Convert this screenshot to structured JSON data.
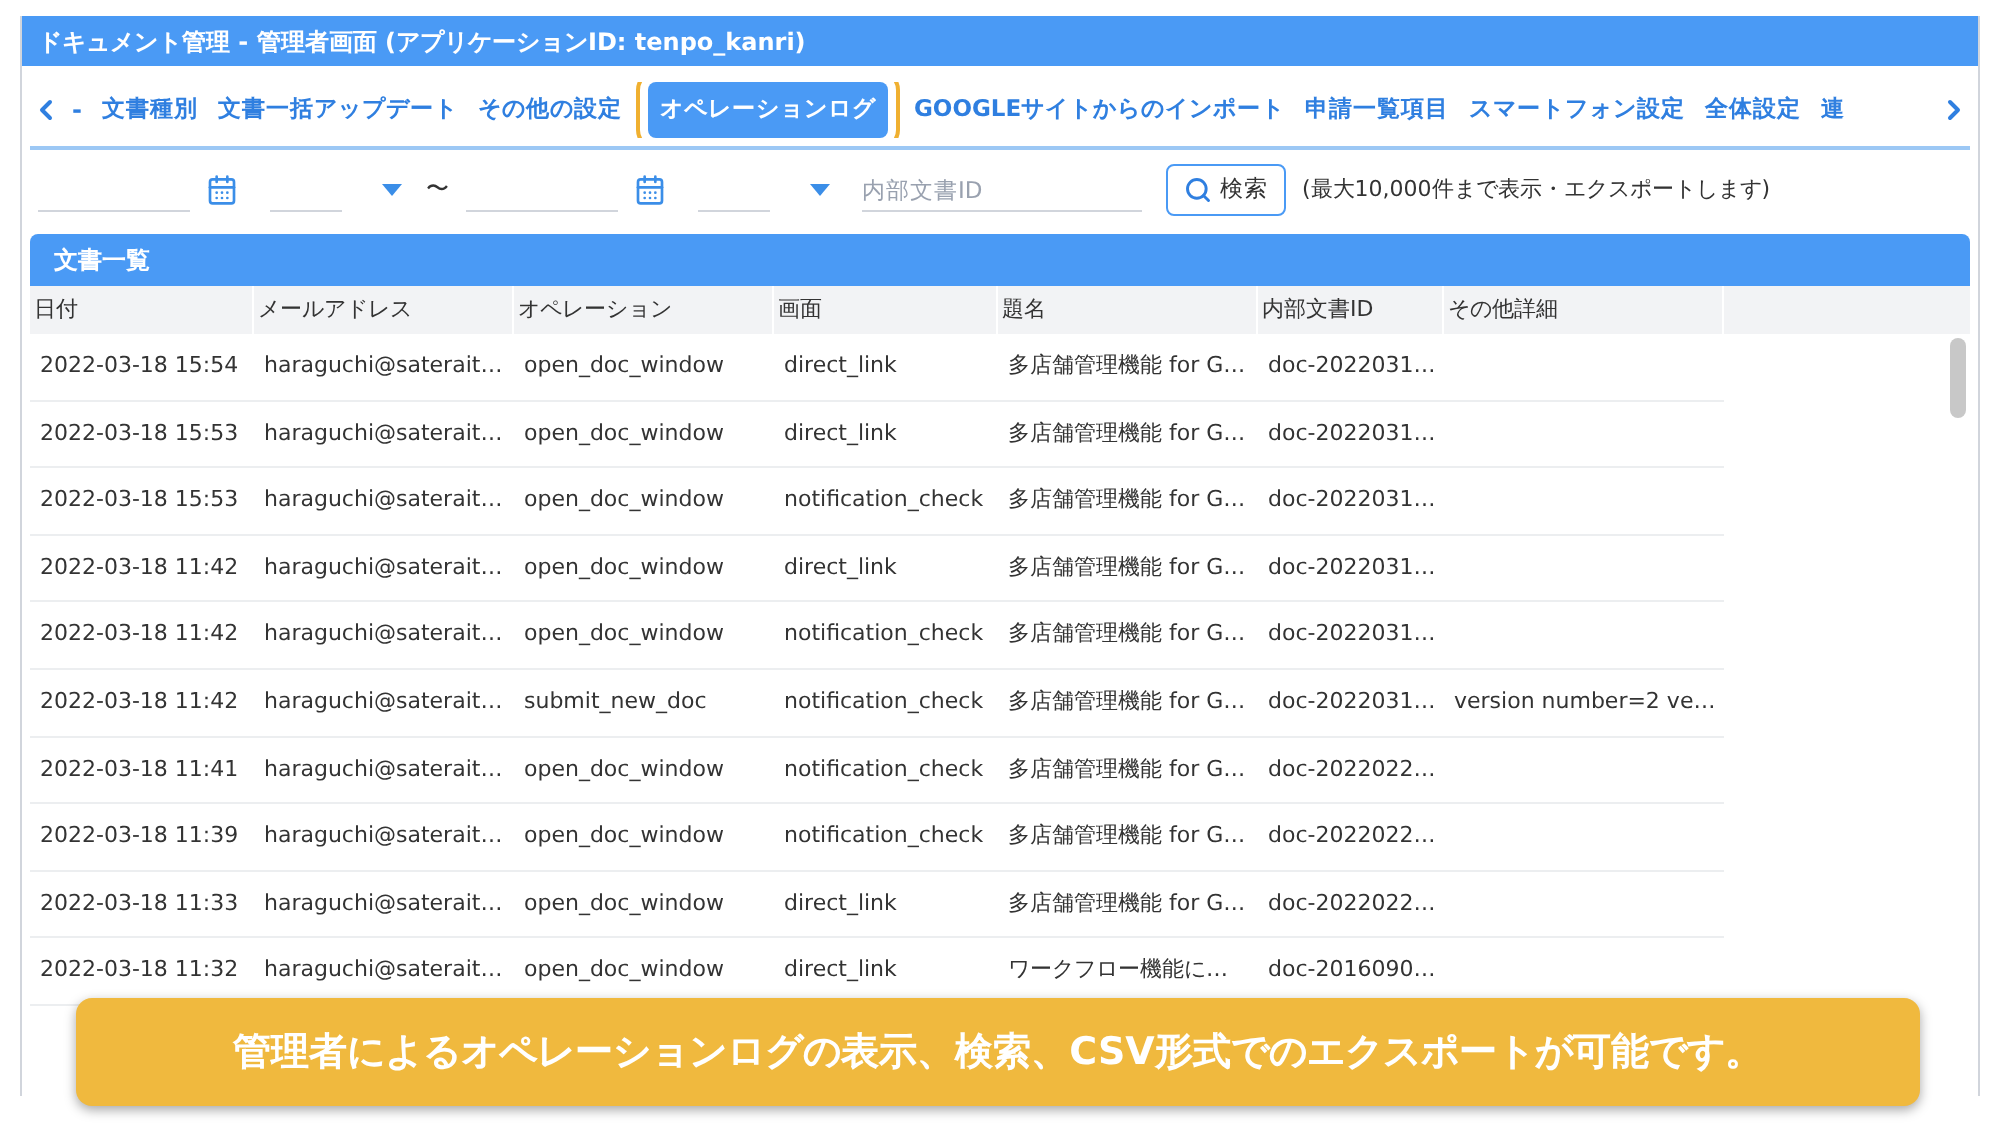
{
  "window": {
    "title": "ドキュメント管理 - 管理者画面 (アプリケーションID: tenpo_kanri)"
  },
  "tab_nav": {
    "prev_label": "-"
  },
  "tabs": [
    {
      "label": "文書種別",
      "selected": false
    },
    {
      "label": "文書一括アップデート",
      "selected": false
    },
    {
      "label": "その他の設定",
      "selected": false
    },
    {
      "label": "オペレーションログ",
      "selected": true
    },
    {
      "label": "GOOGLEサイトからのインポート",
      "selected": false
    },
    {
      "label": "申請一覧項目",
      "selected": false
    },
    {
      "label": "スマートフォン設定",
      "selected": false
    },
    {
      "label": "全体設定",
      "selected": false
    },
    {
      "label": "連",
      "selected": false
    }
  ],
  "filter": {
    "range_separator": "〜",
    "doc_id_placeholder": "内部文書ID",
    "search_button": "検索",
    "note": "(最大10,000件まで表示・エクスポートします)"
  },
  "panel": {
    "title": "文書一覧"
  },
  "table": {
    "columns": [
      "日付",
      "メールアドレス",
      "オペレーション",
      "画面",
      "題名",
      "内部文書ID",
      "その他詳細"
    ],
    "rows": [
      [
        "2022-03-18 15:54",
        "haraguchi@saterait…",
        "open_doc_window",
        "direct_link",
        "多店舗管理機能 for G…",
        "doc-2022031…",
        ""
      ],
      [
        "2022-03-18 15:53",
        "haraguchi@saterait…",
        "open_doc_window",
        "direct_link",
        "多店舗管理機能 for G…",
        "doc-2022031…",
        ""
      ],
      [
        "2022-03-18 15:53",
        "haraguchi@saterait…",
        "open_doc_window",
        "notification_check",
        "多店舗管理機能 for G…",
        "doc-2022031…",
        ""
      ],
      [
        "2022-03-18 11:42",
        "haraguchi@saterait…",
        "open_doc_window",
        "direct_link",
        "多店舗管理機能 for G…",
        "doc-2022031…",
        ""
      ],
      [
        "2022-03-18 11:42",
        "haraguchi@saterait…",
        "open_doc_window",
        "notification_check",
        "多店舗管理機能 for G…",
        "doc-2022031…",
        ""
      ],
      [
        "2022-03-18 11:42",
        "haraguchi@saterait…",
        "submit_new_doc",
        "notification_check",
        "多店舗管理機能 for G…",
        "doc-2022031…",
        "version number=2 ve…"
      ],
      [
        "2022-03-18 11:41",
        "haraguchi@saterait…",
        "open_doc_window",
        "notification_check",
        "多店舗管理機能 for G…",
        "doc-2022022…",
        ""
      ],
      [
        "2022-03-18 11:39",
        "haraguchi@saterait…",
        "open_doc_window",
        "notification_check",
        "多店舗管理機能 for G…",
        "doc-2022022…",
        ""
      ],
      [
        "2022-03-18 11:33",
        "haraguchi@saterait…",
        "open_doc_window",
        "direct_link",
        "多店舗管理機能 for G…",
        "doc-2022022…",
        ""
      ],
      [
        "2022-03-18 11:32",
        "haraguchi@saterait…",
        "open_doc_window",
        "direct_link",
        "ワークフロー機能に…",
        "doc-2016090…",
        ""
      ]
    ]
  },
  "banner": {
    "text": "管理者によるオペレーションログの表示、検索、CSV形式でのエクスポートが可能です。"
  }
}
